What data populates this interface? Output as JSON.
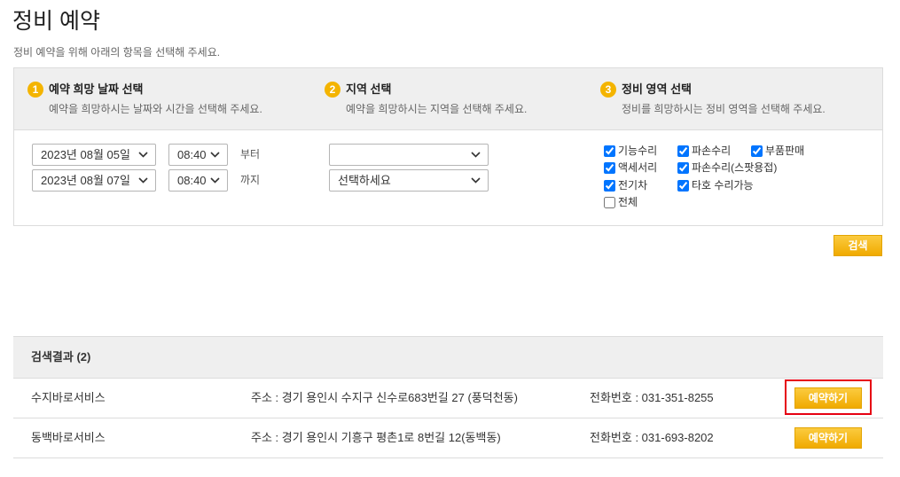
{
  "page": {
    "title": "정비 예약",
    "subtitle": "정비 예약을 위해 아래의 항목을 선택해 주세요."
  },
  "steps": [
    {
      "number": "1",
      "title": "예약 희망 날짜 선택",
      "desc": "예약을 희망하시는 날짜와 시간을 선택해 주세요."
    },
    {
      "number": "2",
      "title": "지역 선택",
      "desc": "예약을 희망하시는 지역을 선택해 주세요."
    },
    {
      "number": "3",
      "title": "정비 영역 선택",
      "desc": "정비를 희망하시는 정비 영역을 선택해 주세요."
    }
  ],
  "date": {
    "start_date": "2023년 08월 05일",
    "start_time": "08:40",
    "start_suffix": "부터",
    "end_date": "2023년 08월 07일",
    "end_time": "08:40",
    "end_suffix": "까지"
  },
  "region": {
    "primary": "",
    "secondary": "선택하세요"
  },
  "areas": [
    {
      "label": "기능수리",
      "checked": true
    },
    {
      "label": "파손수리",
      "checked": true
    },
    {
      "label": "부품판매",
      "checked": true
    },
    {
      "label": "액세서리",
      "checked": true
    },
    {
      "label": "파손수리(스팟용접)",
      "checked": true
    },
    {
      "label": "전기차",
      "checked": true
    },
    {
      "label": "타호 수리가능",
      "checked": true
    },
    {
      "label": "전체",
      "checked": false
    }
  ],
  "search_label": "검색",
  "results": {
    "header": "검색결과 (2)",
    "rows": [
      {
        "name": "수지바로서비스",
        "address": "주소 : 경기 용인시 수지구 신수로683번길 27 (풍덕천동)",
        "phone": "전화번호 : 031-351-8255",
        "button": "예약하기"
      },
      {
        "name": "동백바로서비스",
        "address": "주소 : 경기 용인시 기흥구 평촌1로 8번길 12(동백동)",
        "phone": "전화번호 : 031-693-8202",
        "button": "예약하기"
      }
    ]
  },
  "icons": {
    "select_indicator": "chevron-down-icon"
  },
  "colors": {
    "accent": "#f4b400",
    "button_gold": "#f0aa00",
    "highlight": "#e60012",
    "checkbox": "#0075ff"
  }
}
